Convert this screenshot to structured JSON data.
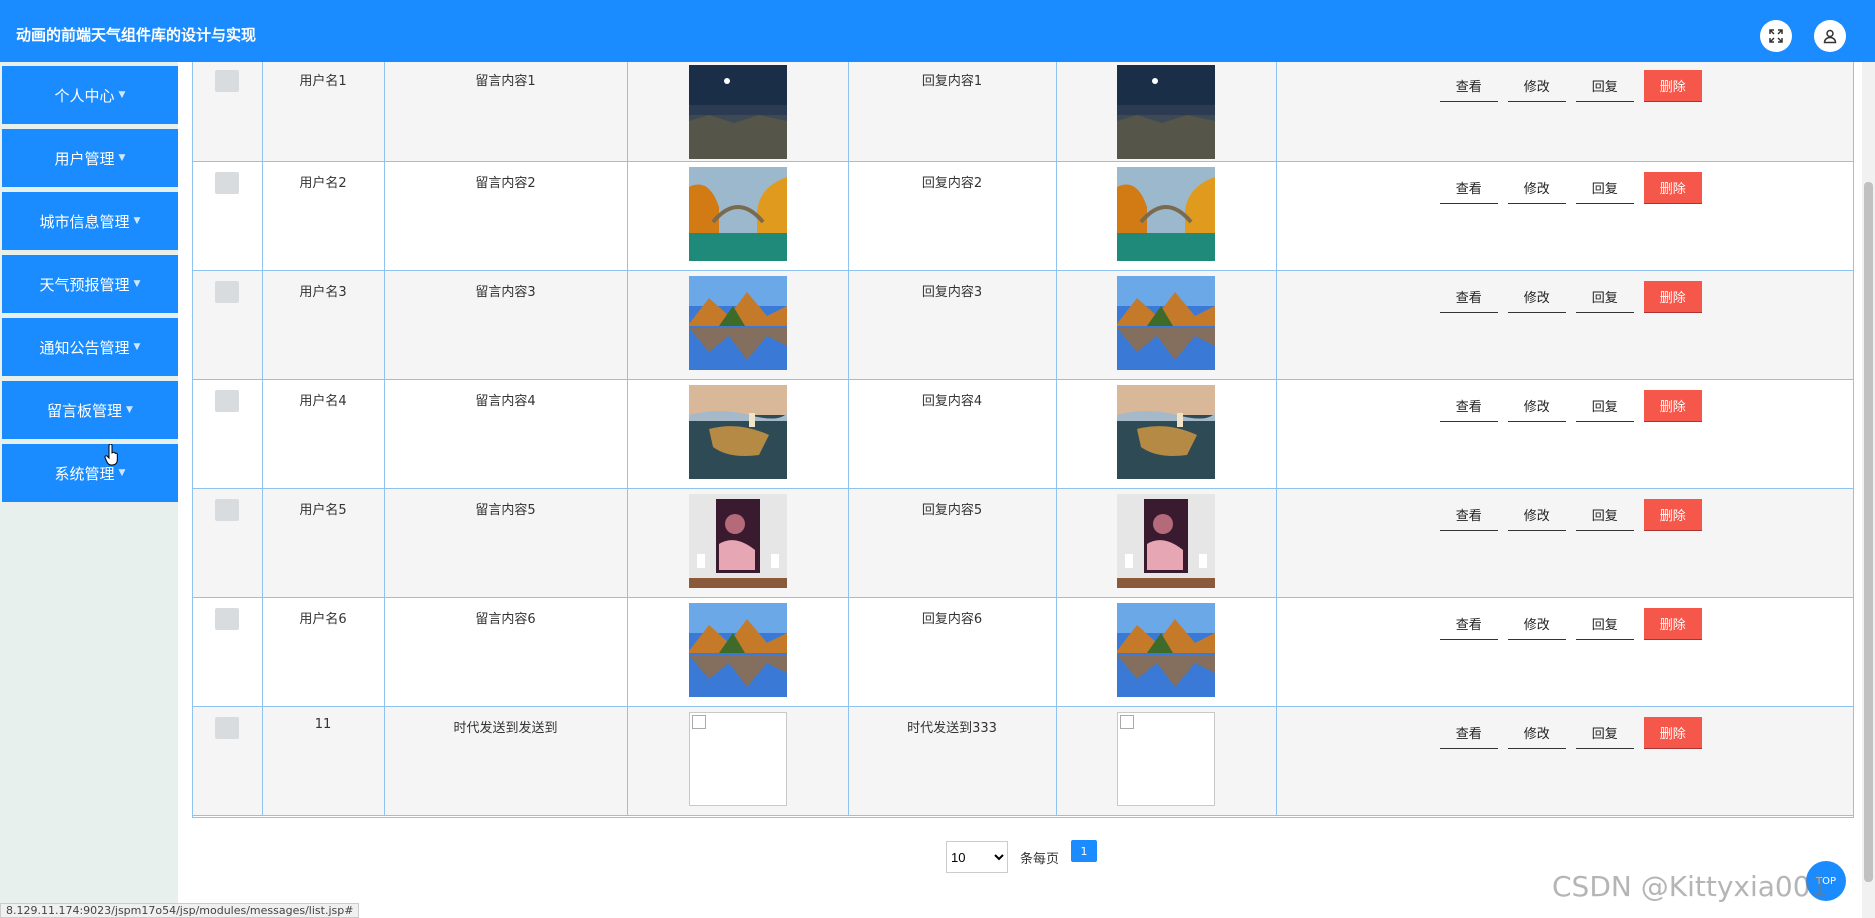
{
  "header": {
    "title": "动画的前端天气组件库的设计与实现"
  },
  "sidebar": {
    "items": [
      {
        "label": "个人中心"
      },
      {
        "label": "用户管理"
      },
      {
        "label": "城市信息管理"
      },
      {
        "label": "天气预报管理"
      },
      {
        "label": "通知公告管理"
      },
      {
        "label": "留言板管理"
      },
      {
        "label": "系统管理"
      }
    ]
  },
  "actions": {
    "view": "查看",
    "edit": "修改",
    "reply": "回复",
    "delete": "删除"
  },
  "rows": [
    {
      "username": "用户名1",
      "content": "留言内容1",
      "reply": "回复内容1",
      "image": "night-sky-lake"
    },
    {
      "username": "用户名2",
      "content": "留言内容2",
      "reply": "回复内容2",
      "image": "autumn-bridge"
    },
    {
      "username": "用户名3",
      "content": "留言内容3",
      "reply": "回复内容3",
      "image": "mountain-lake"
    },
    {
      "username": "用户名4",
      "content": "留言内容4",
      "reply": "回复内容4",
      "image": "sunset-island"
    },
    {
      "username": "用户名5",
      "content": "留言内容5",
      "reply": "回复内容5",
      "image": "pink-poster"
    },
    {
      "username": "用户名6",
      "content": "留言内容6",
      "reply": "回复内容6",
      "image": "mountain-lake"
    },
    {
      "username": "11",
      "content": "时代发送到发送到",
      "reply": "时代发送到333",
      "image": "broken"
    }
  ],
  "pager": {
    "page_size": "10",
    "per_page_label": "条每页",
    "current_page": "1"
  },
  "top_button": "TOP",
  "status_url": "8.129.11.174:9023/jspm17o54/jsp/modules/messages/list.jsp#",
  "watermark": "CSDN @Kittyxia001",
  "colors": {
    "primary": "#1a8cff",
    "danger": "#f5574a",
    "sidebar_bg": "#e8f0ee"
  }
}
